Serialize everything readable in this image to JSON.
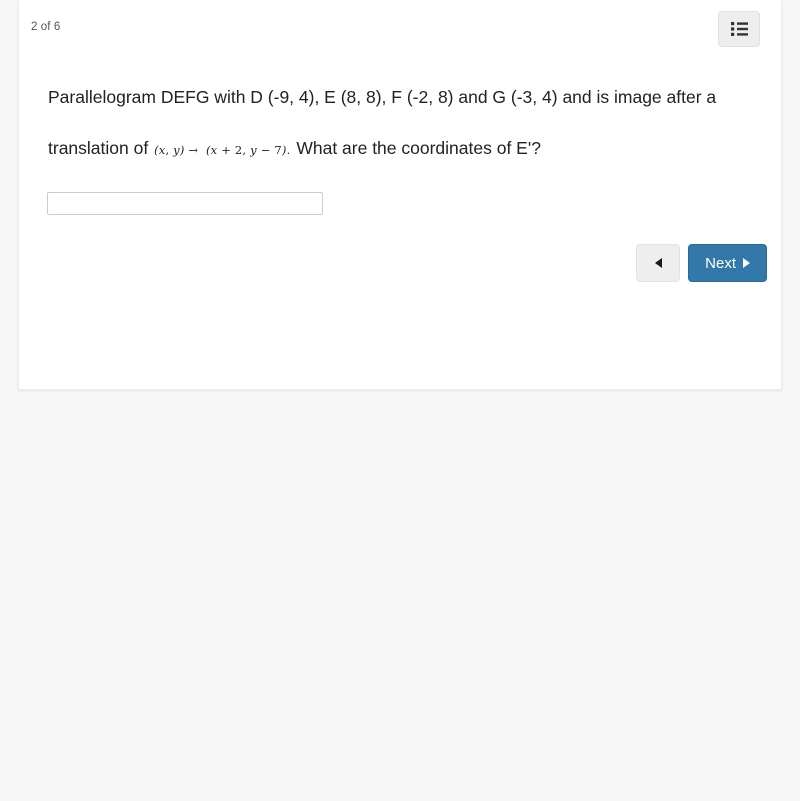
{
  "page": {
    "background_color": "#f7f7f7"
  },
  "alert": {
    "name": "notification-strip",
    "background_color": "#f4faf0",
    "border_color": "#cfe3bd"
  },
  "card": {
    "background_color": "#ffffff",
    "counter": "2 of 6",
    "menu_icon": "list-icon"
  },
  "question": {
    "line1": "Parallelogram DEFG with D (-9, 4), E (8, 8), F (-2, 8) and G (-3, 4) and is image",
    "line2_prefix": "after a translation of ",
    "formula": {
      "lhs_open": "(",
      "lhs_x": "x",
      "lhs_comma": ", ",
      "lhs_y": "y",
      "lhs_close": ")",
      "arrow": "→",
      "rhs_open": "(",
      "rhs_x": "x",
      "rhs_plus": " + ",
      "rhs_dx": "2",
      "rhs_comma": ", ",
      "rhs_y": "y",
      "rhs_minus": " − ",
      "rhs_dy": "7",
      "rhs_close": ")",
      "period": "."
    },
    "line2_suffix": " What are the coordinates of E'?"
  },
  "answer": {
    "value": "",
    "placeholder": ""
  },
  "nav": {
    "prev_label": "",
    "prev_icon": "triangle-left-icon",
    "next_label": "Next",
    "next_icon": "triangle-right-icon",
    "next_color": "#3278a8"
  }
}
